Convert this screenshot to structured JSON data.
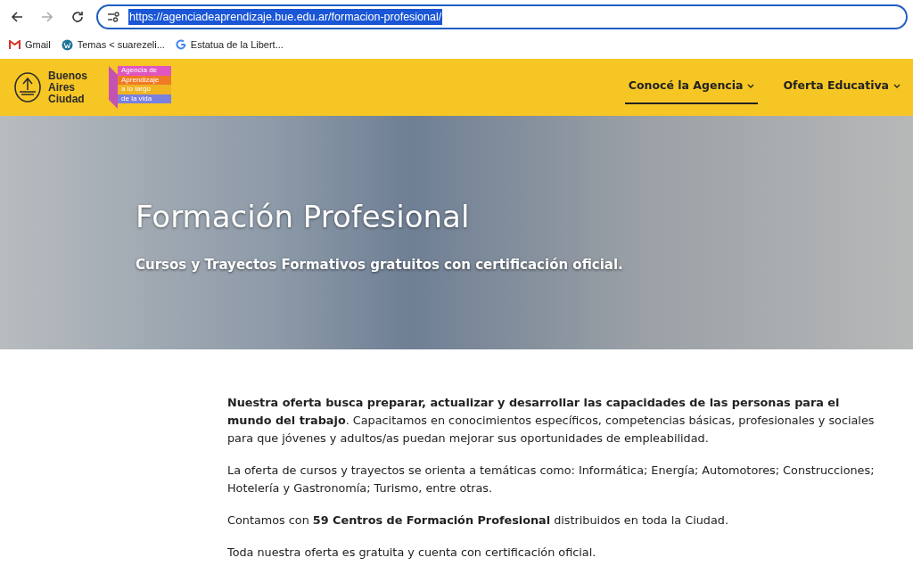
{
  "browser": {
    "url": "https://agenciadeaprendizaje.bue.edu.ar/formacion-profesional/",
    "bookmarks": [
      {
        "kind": "gmail",
        "label": "Gmail"
      },
      {
        "kind": "wordpress",
        "label": "Temas < suarezeli..."
      },
      {
        "kind": "google",
        "label": "Estatua de la Libert..."
      }
    ]
  },
  "header": {
    "logo_text": [
      "Buenos",
      "Aires",
      "Ciudad"
    ],
    "badge_lines": [
      "Agencia de",
      "Aprendizaje",
      "a lo largo",
      "de la vida"
    ],
    "nav": [
      {
        "label": "Conocé la Agencia",
        "selected": true
      },
      {
        "label": "Oferta Educativa",
        "selected": false
      }
    ]
  },
  "hero": {
    "title": "Formación Profesional",
    "subtitle": "Cursos y Trayectos Formativos gratuitos con certificación oficial."
  },
  "paragraphs": [
    "**Nuestra oferta busca preparar, actualizar y desarrollar las capacidades de las personas para el mundo del trabajo**. Capacitamos en conocimientos específicos, competencias básicas, profesionales y sociales para que jóvenes y adultos/as puedan mejorar sus oportunidades de empleabilidad.",
    "La oferta de cursos y trayectos se orienta a temáticas como: Informática; Energía; Automotores; Construcciones; Hotelería y Gastronomía; Turismo, entre otras.",
    "Contamos con **59 Centros de Formación Profesional** distribuidos en toda la Ciudad.",
    "Toda nuestra oferta es gratuita y cuenta con certificación oficial."
  ]
}
